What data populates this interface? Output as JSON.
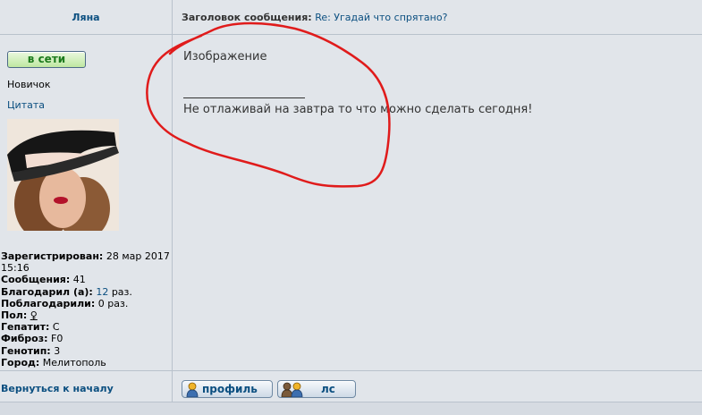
{
  "post": {
    "author": "Ляна",
    "subject_label": "Заголовок сообщения:",
    "subject_value": "Re: Угадай что спрятано?"
  },
  "user": {
    "status": "в сети",
    "rank": "Новичок",
    "quote": "Цитата",
    "avatar_icon": "avatar-woman-hat"
  },
  "profile": {
    "registered_label": "Зарегистрирован:",
    "registered_value": "28 мар 2017 15:16",
    "posts_label": "Сообщения:",
    "posts_value": "41",
    "thanked_label": "Благодарил (а):",
    "thanked_count": "12",
    "thanked_suffix": "раз.",
    "thanked_by_label": "Поблагодарили:",
    "thanked_by_value": "0 раз.",
    "gender_label": "Пол:",
    "gender_value": "♀",
    "hepatitis_label": "Гепатит:",
    "hepatitis_value": "С",
    "fibrosis_label": "Фиброз:",
    "fibrosis_value": "F0",
    "genotype_label": "Генотип:",
    "genotype_value": "3",
    "city_label": "Город:",
    "city_value": "Мелитополь"
  },
  "message": {
    "body": "Изображение",
    "signature": "Не отлаживай на завтра то что можно сделать сегодня!"
  },
  "footer": {
    "back_to_top": "Вернуться к началу",
    "profile_button": "профиль",
    "pm_button": "лс"
  },
  "colors": {
    "link": "#0b4f80",
    "online": "#1d7b1d",
    "scribble": "#e01b1b",
    "background": "#e1e5ea"
  }
}
